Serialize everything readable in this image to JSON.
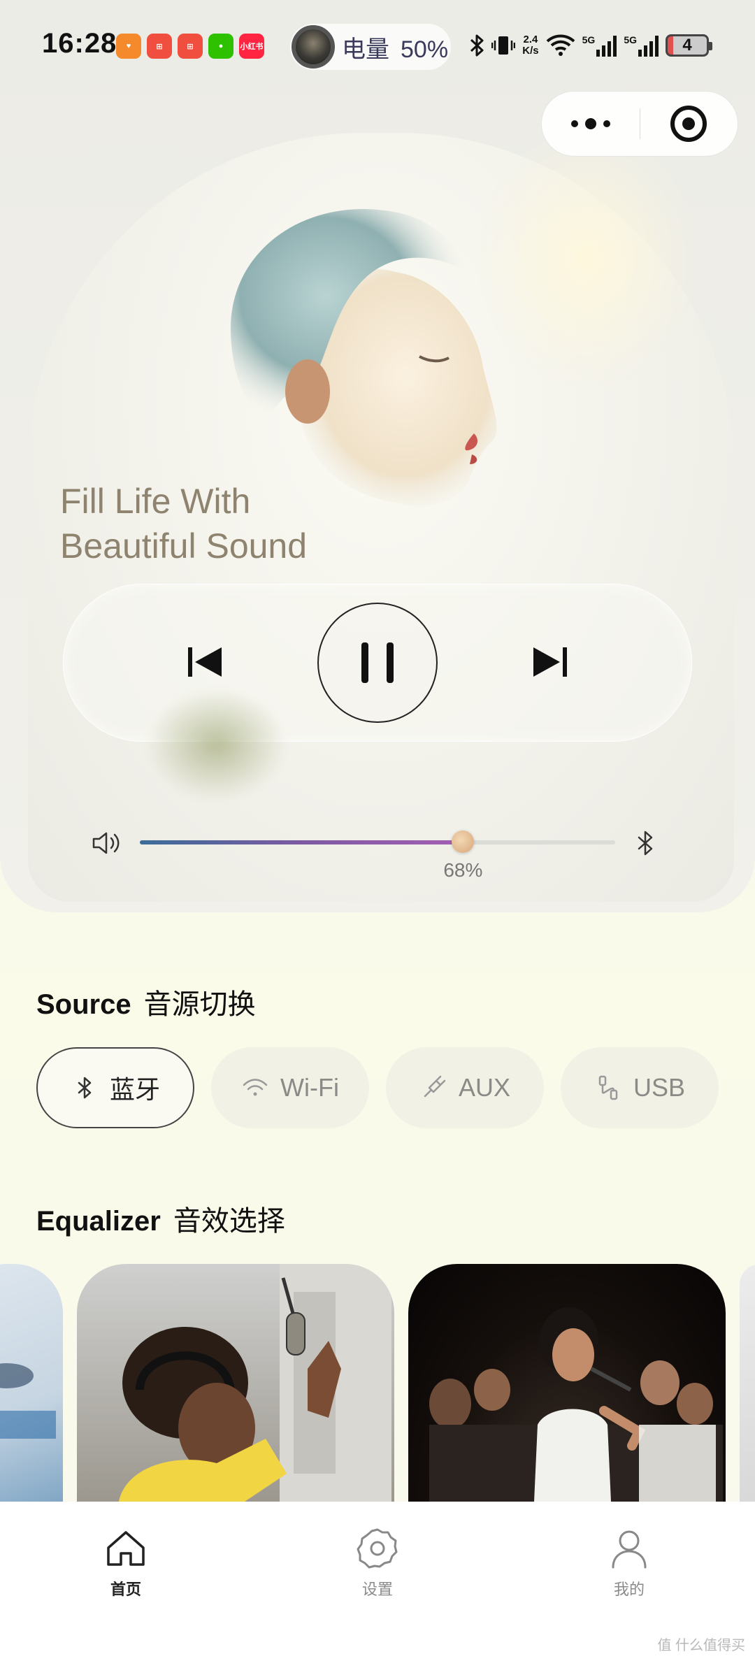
{
  "status_bar": {
    "time": "16:28",
    "battery_pill_label": "电量",
    "battery_pill_value": "50%",
    "network_speed_top": "2.4",
    "network_speed_bottom": "K/s",
    "network_1": "5G",
    "network_2": "5G",
    "battery_level": "4",
    "app_icons": [
      "taobao-icon",
      "pinduoduo-icon",
      "pinduoduo-icon-2",
      "wechat-icon",
      "xiaohongshu-icon"
    ],
    "xiaohongshu_text": "小红书"
  },
  "hero": {
    "tagline_line1": "Fill Life With",
    "tagline_line2": "Beautiful Sound",
    "volume_percent": 68,
    "volume_label": "68%"
  },
  "source": {
    "title_en": "Source",
    "title_zh": "音源切换",
    "options": [
      {
        "label": "蓝牙",
        "icon": "bluetooth-icon",
        "active": true
      },
      {
        "label": "Wi-Fi",
        "icon": "wifi-icon",
        "active": false
      },
      {
        "label": "AUX",
        "icon": "aux-icon",
        "active": false
      },
      {
        "label": "USB",
        "icon": "usb-icon",
        "active": false
      }
    ]
  },
  "equalizer": {
    "title_en": "Equalizer",
    "title_zh": "音效选择"
  },
  "tabs": [
    {
      "label": "首页",
      "icon": "home-icon",
      "active": true
    },
    {
      "label": "设置",
      "icon": "settings-gear-icon",
      "active": false
    },
    {
      "label": "我的",
      "icon": "profile-icon",
      "active": false
    }
  ],
  "watermark": "值 什么值得买",
  "colors": {
    "slider_gradient_start": "#3b6c9a",
    "slider_gradient_end": "#a45fb3",
    "tagline": "#8d836e"
  }
}
